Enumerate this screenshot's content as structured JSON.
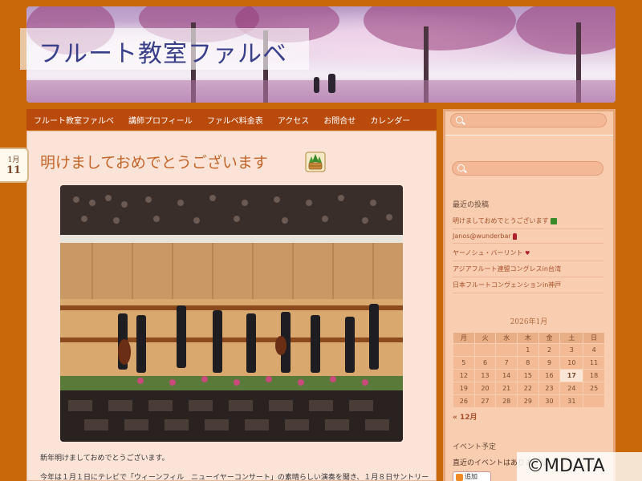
{
  "site": {
    "title": "フルート教室ファルベ"
  },
  "nav": {
    "items": [
      "フルート教室ファルベ",
      "講師プロフィール",
      "ファルベ料金表",
      "アクセス",
      "お問合せ",
      "カレンダー"
    ]
  },
  "post": {
    "date_month": "1月",
    "date_day": "11",
    "title": "明けましておめでとうございます",
    "title_emoji": "kadomatsu-icon",
    "body_lines": [
      "新年明けましておめでとうございます。",
      "今年は１月１日にテレビで「ウィーンフィル　ニューイヤーコンサート」の素晴らしい演奏を聞き、１月８日サントリー"
    ]
  },
  "sidebar": {
    "recent_title": "最近の投稿",
    "recent_posts": [
      "明けましておめでとうございます",
      "Janos@wunderbar",
      "ヤーノシュ・バーリント",
      "アジアフルート連盟コングレスin台湾",
      "日本フルートコンヴェンションin神戸"
    ],
    "calendar": {
      "caption": "2026年1月",
      "headers": [
        "月",
        "火",
        "水",
        "木",
        "金",
        "土",
        "日"
      ],
      "weeks": [
        [
          "",
          "",
          "",
          "1",
          "2",
          "3",
          "4"
        ],
        [
          "5",
          "6",
          "7",
          "8",
          "9",
          "10",
          "11"
        ],
        [
          "12",
          "13",
          "14",
          "15",
          "16",
          "17",
          "18"
        ],
        [
          "19",
          "20",
          "21",
          "22",
          "23",
          "24",
          "25"
        ],
        [
          "26",
          "27",
          "28",
          "29",
          "30",
          "31",
          ""
        ]
      ],
      "today": "17",
      "prev_link": "« 12月"
    },
    "events_title": "イベント予定",
    "events_text": "直近のイベントはありません",
    "add_button": "追加"
  },
  "watermark": "©MDATA",
  "colors": {
    "background": "#c8680a",
    "nav_bg": "#b94a0c",
    "title_color": "#c4652a",
    "link_color": "#a5502a"
  }
}
